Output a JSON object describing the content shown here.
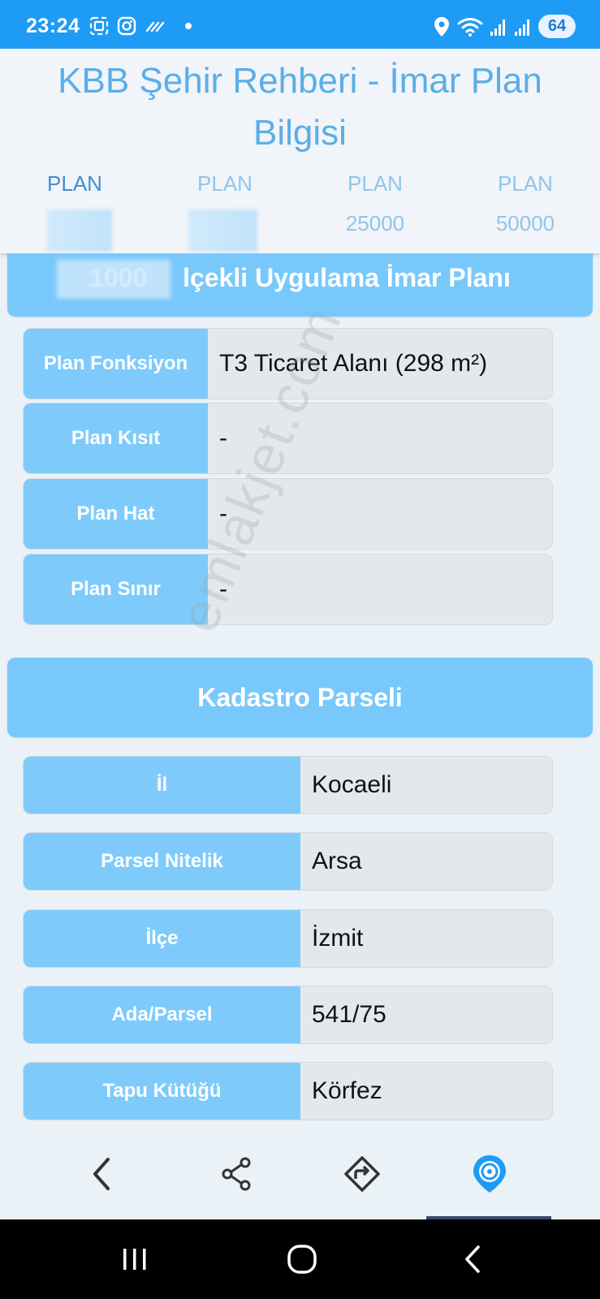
{
  "status_bar": {
    "time": "23:24",
    "battery": "64"
  },
  "header": {
    "title": "KBB Şehir Rehberi - İmar Plan Bilgisi",
    "tabs": [
      {
        "line1": "PLAN",
        "line2": "",
        "active": true
      },
      {
        "line1": "PLAN",
        "line2": "",
        "active": false
      },
      {
        "line1": "PLAN",
        "line2": "25000",
        "active": false
      },
      {
        "line1": "PLAN",
        "line2": "50000",
        "active": false
      }
    ]
  },
  "plan_section": {
    "title_prefix": "1000",
    "title_rest": "lçekli Uygulama İmar Planı",
    "rows": [
      {
        "label": "Plan Fonksiyon",
        "value": "T3 Ticaret Alanı (298 m²)"
      },
      {
        "label": "Plan Kısıt",
        "value": "-"
      },
      {
        "label": "Plan Hat",
        "value": "-"
      },
      {
        "label": "Plan Sınır",
        "value": "-"
      }
    ]
  },
  "kadastro_section": {
    "title": "Kadastro Parseli",
    "rows": [
      {
        "label": "İl",
        "value": "Kocaeli"
      },
      {
        "label": "Parsel Nitelik",
        "value": "Arsa"
      },
      {
        "label": "İlçe",
        "value": "İzmit"
      },
      {
        "label": "Ada/Parsel",
        "value": "541/75"
      },
      {
        "label": "Tapu Kütüğü",
        "value": "Körfez"
      }
    ]
  },
  "watermark": "emlakjet.com",
  "app_nav": {
    "icons": [
      "back-arrow-icon",
      "share-icon",
      "route-icon",
      "location-icon"
    ]
  },
  "system_nav": {
    "icons": [
      "recents-icon",
      "home-icon",
      "back-icon"
    ]
  },
  "colors": {
    "status_bar": "#1e9bf4",
    "title": "#5aaee8",
    "banner": "#79c8fb",
    "label_bg": "#7ecbfb",
    "value_bg": "#e4e8eb"
  }
}
